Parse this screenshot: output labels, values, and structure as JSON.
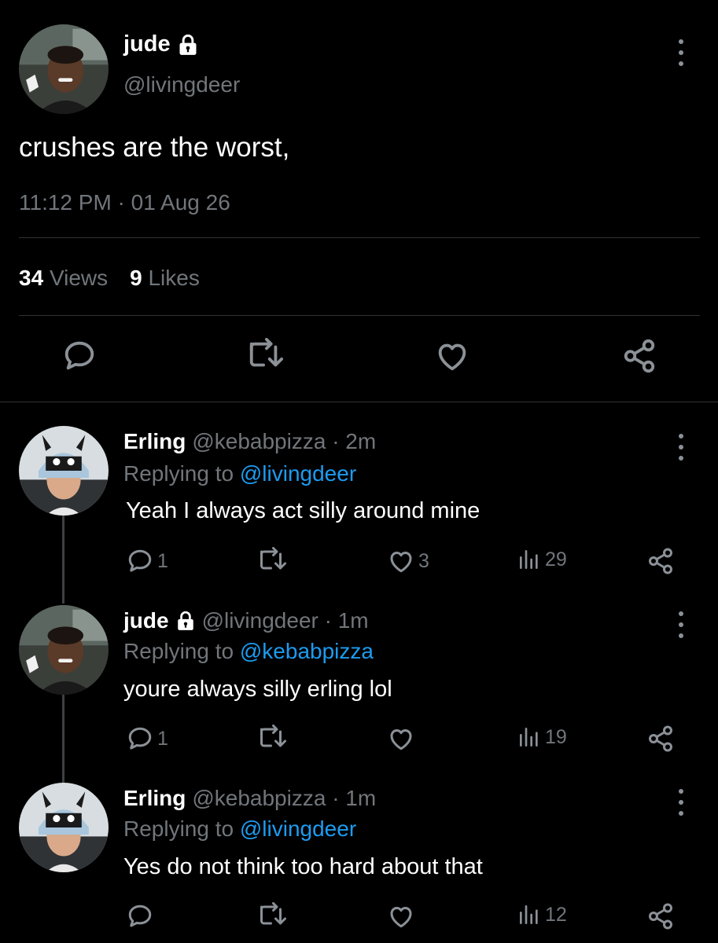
{
  "main_tweet": {
    "author_name": "jude",
    "handle": "@livingdeer",
    "text": "crushes are the worst,",
    "timestamp": "11:12 PM · 01 Aug 26",
    "views_count": "34",
    "views_label": "Views",
    "likes_count": "9",
    "likes_label": "Likes"
  },
  "replies": [
    {
      "name": "Erling",
      "handle_time": "@kebabpizza · 2m",
      "replying_prefix": "Replying to",
      "replying_to": "@livingdeer",
      "text": "Yeah I always act silly around mine",
      "reply_count": "1",
      "like_count": "3",
      "views": "29"
    },
    {
      "name": "jude",
      "handle_time": "@livingdeer · 1m",
      "replying_prefix": "Replying to",
      "replying_to": "@kebabpizza",
      "text": "youre always silly erling lol",
      "reply_count": "1",
      "like_count": "",
      "views": "19"
    },
    {
      "name": "Erling",
      "handle_time": "@kebabpizza · 1m",
      "replying_prefix": "Replying to",
      "replying_to": "@livingdeer",
      "text": "Yes do not think too hard about that",
      "reply_count": "",
      "like_count": "",
      "views": "12"
    }
  ],
  "colors": {
    "background": "#000000",
    "text_primary": "#ffffff",
    "text_secondary": "#71767b",
    "link": "#1d9bf0",
    "divider": "#2f3336"
  },
  "icons": [
    "lock-icon",
    "more-icon",
    "reply-icon",
    "retweet-icon",
    "like-icon",
    "share-icon",
    "views-icon"
  ]
}
